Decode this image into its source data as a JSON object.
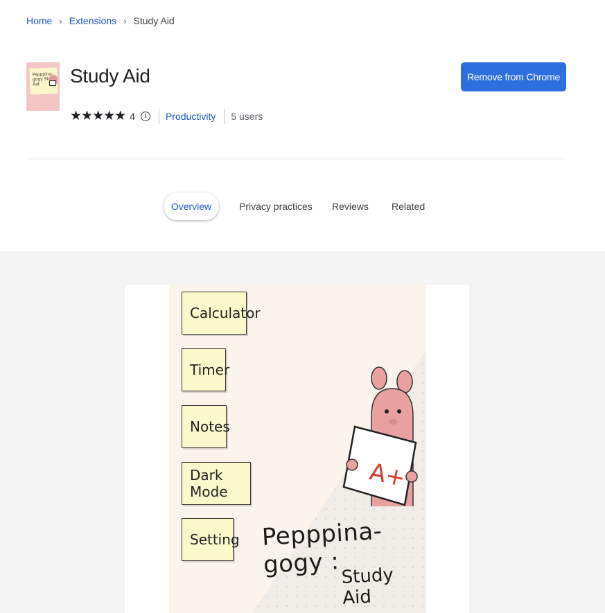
{
  "breadcrumb": {
    "home": "Home",
    "extensions": "Extensions",
    "current": "Study Aid",
    "separator": "›"
  },
  "extension": {
    "icon_text": "Pepppina-gogy Study Aid",
    "title": "Study Aid",
    "stars": "★★★★★",
    "rating_count": "4",
    "info_glyph": "i",
    "category": "Productivity",
    "users": "5 users"
  },
  "action": {
    "remove_label": "Remove from Chrome",
    "color": "#2e6fe0"
  },
  "tabs": [
    {
      "label": "Overview",
      "active": true
    },
    {
      "label": "Privacy practices",
      "active": false
    },
    {
      "label": "Reviews",
      "active": false
    },
    {
      "label": "Related",
      "active": false
    }
  ],
  "screenshot": {
    "features": [
      "Calculator",
      "Timer",
      "Notes",
      "Dark Mode",
      "Setting"
    ],
    "card_text": "A+",
    "caption_line1": "Pepppina-gogy :",
    "caption_line2": "Study Aid"
  },
  "colors": {
    "link": "#1a56c9",
    "note_yellow": "#fbf8cc",
    "pig_pink": "#e8a0a0"
  }
}
